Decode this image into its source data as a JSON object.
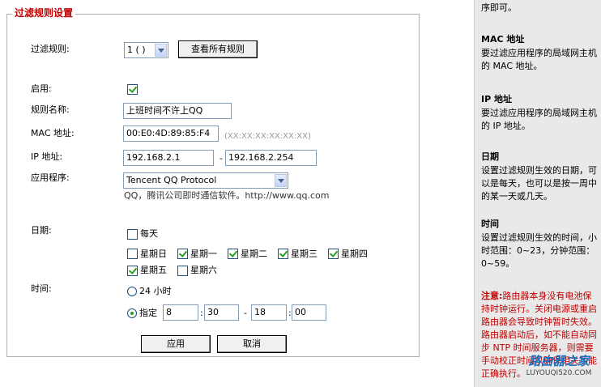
{
  "legend": "过滤规则设置",
  "form": {
    "rule_label": "过滤规则:",
    "rule_select": "1 ( )",
    "view_all_button": "查看所有规则",
    "enable_label": "启用:",
    "enable_checked": true,
    "name_label": "规则名称:",
    "name_value": "上班时间不许上QQ",
    "mac_label": "MAC 地址:",
    "mac_value": "00:E0:4D:89:85:F4",
    "mac_hint": "(XX:XX:XX:XX:XX:XX)",
    "ip_label": "IP 地址:",
    "ip_start": "192.168.2.1",
    "ip_dash": "-",
    "ip_end": "192.168.2.254",
    "app_label": "应用程序:",
    "app_select": "Tencent QQ Protocol",
    "app_desc": "QQ，腾讯公司即时通信软件。http://www.qq.com",
    "date_label": "日期:",
    "everyday": "每天",
    "days": [
      {
        "label": "星期日",
        "checked": false
      },
      {
        "label": "星期一",
        "checked": true
      },
      {
        "label": "星期二",
        "checked": true
      },
      {
        "label": "星期三",
        "checked": true
      },
      {
        "label": "星期四",
        "checked": true
      },
      {
        "label": "星期五",
        "checked": true
      },
      {
        "label": "星期六",
        "checked": false
      }
    ],
    "time_label": "时间:",
    "time_24h": "24 小时",
    "time_custom": "指定",
    "start_hour": "8",
    "start_min": "30",
    "end_hour": "18",
    "end_min": "00",
    "colon": ":",
    "time_dash": "-",
    "apply_button": "应用",
    "cancel_button": "取消"
  },
  "help": {
    "top_text": "序即可。",
    "mac_title": "MAC 地址",
    "mac_text": "要过滤应用程序的局域网主机的 MAC 地址。",
    "ip_title": "IP 地址",
    "ip_text": "要过滤应用程序的局域网主机的 IP 地址。",
    "date_title": "日期",
    "date_text": "设置过滤规则生效的日期，可以是每天，也可以是按一周中的某一天或几天。",
    "time_title": "时间",
    "time_text": "设置过滤规则生效的时间，小时范围：0~23，分钟范围：0~59。",
    "note_title": "注意:",
    "note_text": "路由器本身没有电池保持时钟运行。关闭电源或重启路由器会导致时钟暂时失效。路由器启动后，如不能自动同步 NTP 时间服务器，则需要手动校正时间以确保相关功能正确执行。"
  },
  "watermark": {
    "name": "路由器之家",
    "url": "LUYOUQI520.COM"
  },
  "colors": {
    "legend_red": "#c00000",
    "check_green": "#21a121",
    "help_bg": "#e9e9e9"
  }
}
